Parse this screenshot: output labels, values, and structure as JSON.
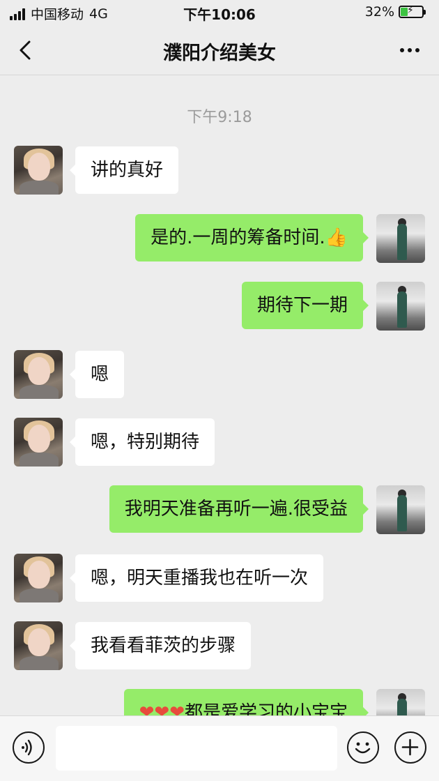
{
  "status_bar": {
    "carrier": "中国移动",
    "network": "4G",
    "time": "下午10:06",
    "battery_percent": "32%",
    "battery_level": 0.32,
    "icons": [
      "signal-icon",
      "battery-charging-icon"
    ]
  },
  "nav": {
    "title": "濮阳介绍美女",
    "icons": [
      "back-chevron-icon",
      "more-icon"
    ]
  },
  "chat": {
    "timestamp": "下午9:18",
    "messages": [
      {
        "from": "them",
        "text": "讲的真好"
      },
      {
        "from": "me",
        "text": "是的.一周的筹备时间.",
        "emoji": "👍"
      },
      {
        "from": "me",
        "text": "期待下一期"
      },
      {
        "from": "them",
        "text": "嗯"
      },
      {
        "from": "them",
        "text": "嗯，特别期待"
      },
      {
        "from": "me",
        "text": "我明天准备再听一遍.很受益"
      },
      {
        "from": "them",
        "text": "嗯，明天重播我也在听一次"
      },
      {
        "from": "them",
        "text": "我看看菲茨的步骤"
      },
      {
        "from": "me",
        "text": "都是爱学习的小宝宝",
        "emoji": "❤❤❤"
      }
    ]
  },
  "input_bar": {
    "icons": [
      "voice-icon",
      "emoji-icon",
      "plus-icon"
    ]
  },
  "colors": {
    "background": "#ededed",
    "my_bubble": "#95ec69",
    "their_bubble": "#ffffff",
    "timestamp": "#9b9b9b"
  }
}
